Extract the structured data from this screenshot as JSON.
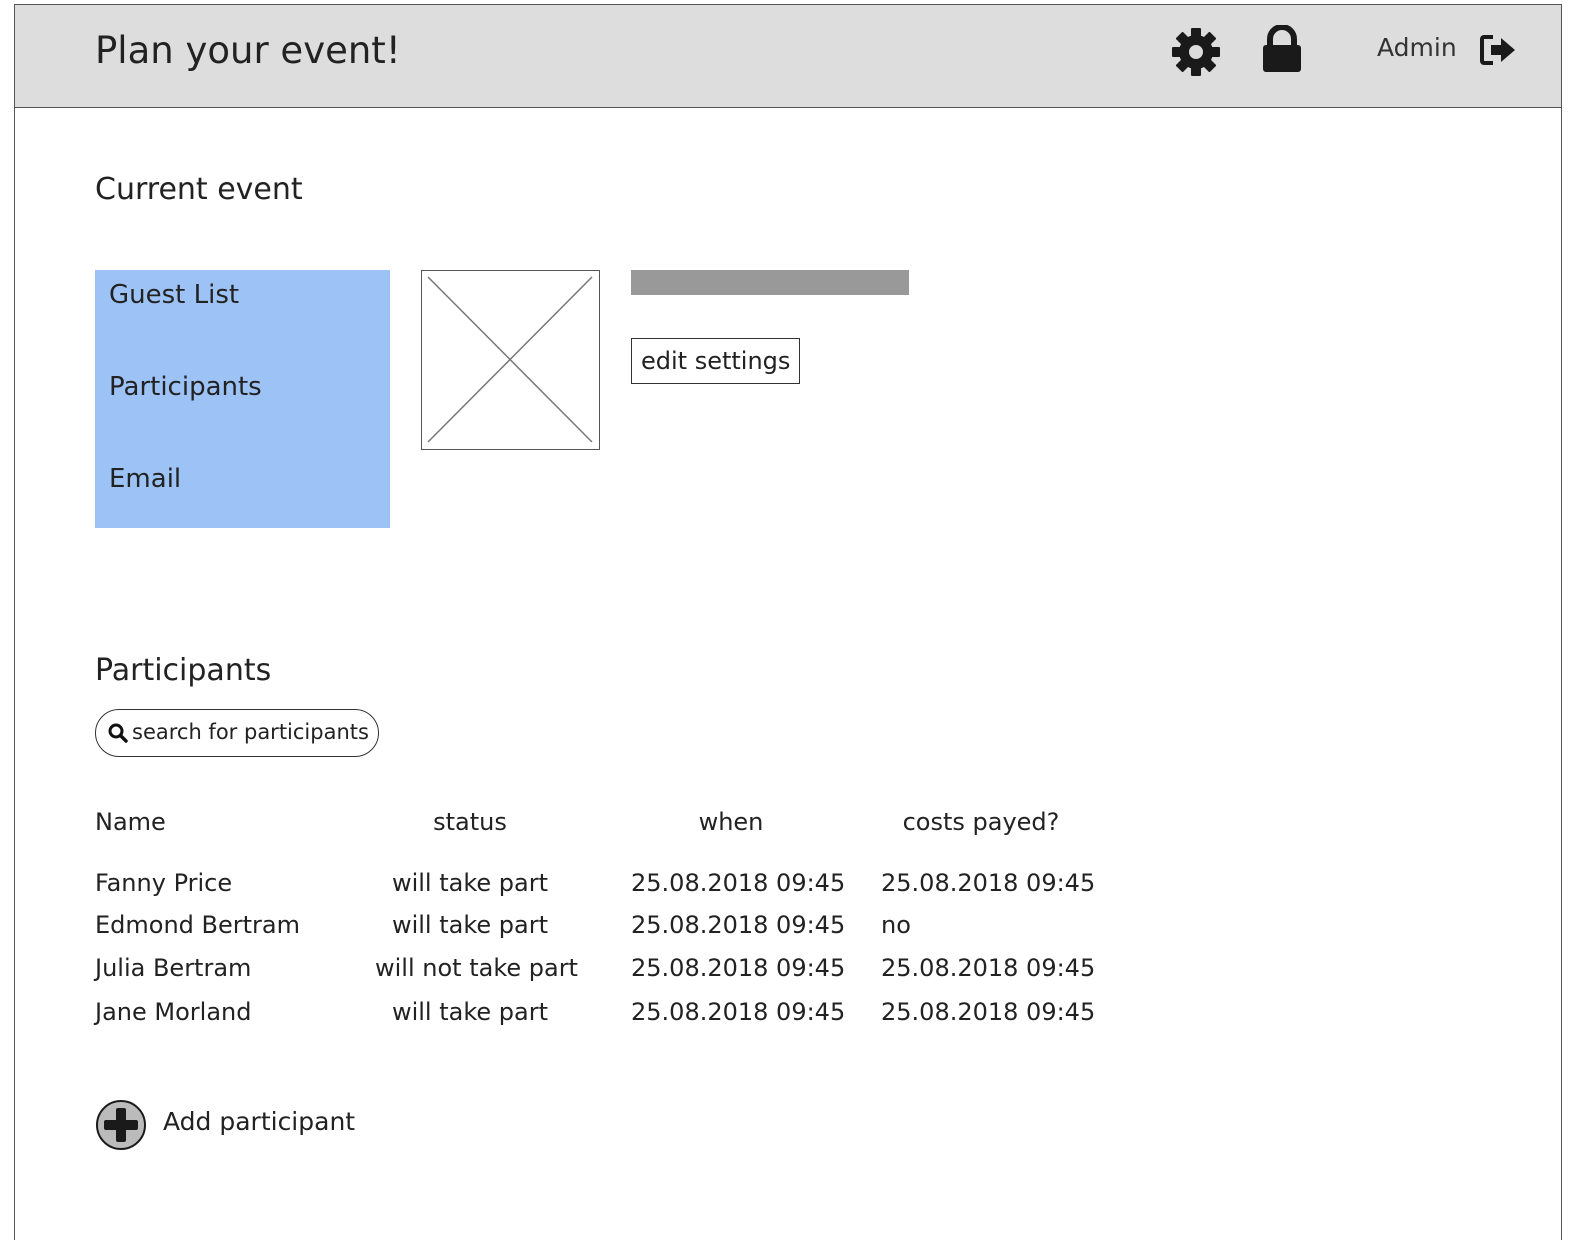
{
  "header": {
    "title": "Plan your event!",
    "settings_icon": "gear-icon",
    "lock_icon": "lock-icon",
    "user": "Admin",
    "logout_icon": "logout-icon"
  },
  "current_event": {
    "title": "Current event",
    "nav": {
      "items": [
        {
          "label": "Guest List"
        },
        {
          "label": "Participants"
        },
        {
          "label": "Email"
        }
      ]
    },
    "image_placeholder": "image-placeholder-icon",
    "edit_button": "edit settings"
  },
  "participants": {
    "title": "Participants",
    "search": {
      "placeholder": "search for participants",
      "value": ""
    },
    "columns": {
      "name": "Name",
      "status": "status",
      "when": "when",
      "costs": "costs payed?"
    },
    "rows": [
      {
        "name": "Fanny Price",
        "status": "will take part",
        "when": "25.08.2018 09:45",
        "costs": "25.08.2018 09:45"
      },
      {
        "name": "Edmond Bertram",
        "status": "will take part",
        "when": "25.08.2018 09:45",
        "costs": "no"
      },
      {
        "name": "Julia Bertram",
        "status": "will not take part",
        "when": "25.08.2018 09:45",
        "costs": "25.08.2018 09:45"
      },
      {
        "name": "Jane Morland",
        "status": "will take part",
        "when": "25.08.2018 09:45",
        "costs": "25.08.2018 09:45"
      }
    ],
    "add_label": "Add participant",
    "add_icon": "plus-circle-icon"
  },
  "colors": {
    "header_bg": "#dddddd",
    "nav_bg": "#9dc3f6",
    "title_bar": "#999999"
  }
}
